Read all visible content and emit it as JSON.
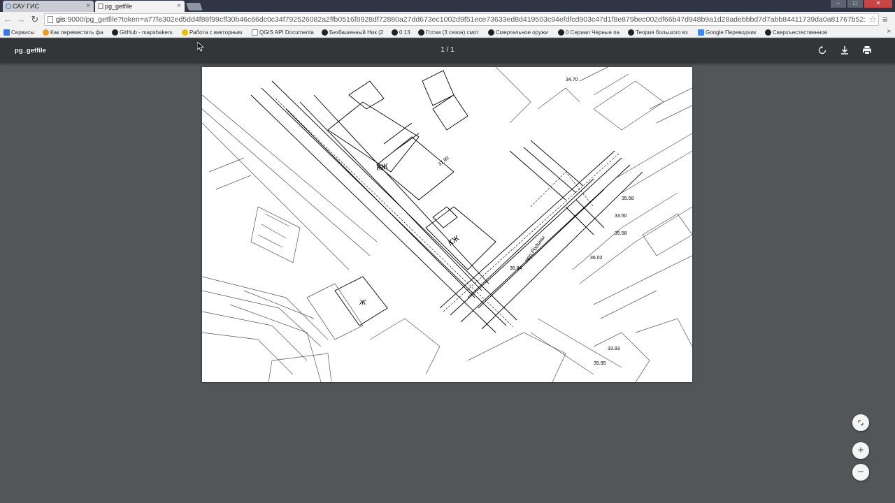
{
  "tabs": [
    {
      "title": "САУ ГИС",
      "active": false
    },
    {
      "title": "pg_getfile",
      "active": true
    }
  ],
  "window_controls": {
    "minimize": "–",
    "maximize": "□",
    "close": "✕"
  },
  "toolbar": {
    "back_icon": "arrow-left-icon",
    "forward_icon": "arrow-right-icon",
    "reload_icon": "reload-icon",
    "url_host": "gis",
    "url_rest": ":9000/pg_getfile?token=a77fe302ed5dd4f88f99cff30b46c66dc0c34f792526082a2ffb0516f8928df72880a27dd673ec1002d9f51ece73633ed8d419503c94efdfcd903c47d1f8e879bec002df66b47d948b9a1d28adebbbd7d7abb84411739da0a81767b52:"
  },
  "bookmarks": [
    {
      "label": "Сервисы",
      "color": "#3b78e7"
    },
    {
      "label": "Как переместить фа",
      "color": "#f09a1a"
    },
    {
      "label": "GitHub - mapshakers",
      "color": "#222222"
    },
    {
      "label": "Работа с векторным",
      "color": "#e8c100"
    },
    {
      "label": "QGIS API Documenta",
      "color": "#888888"
    },
    {
      "label": "Безбашенный Ник (2",
      "color": "#222222"
    },
    {
      "label": "0 13",
      "color": "#222222"
    },
    {
      "label": "Готэм (3 сезон) смот",
      "color": "#222222"
    },
    {
      "label": "Смертельное оружи",
      "color": "#222222"
    },
    {
      "label": "0 Сериал Черные па",
      "color": "#222222"
    },
    {
      "label": "Теория большого вз",
      "color": "#222222"
    },
    {
      "label": "Google Переводчик",
      "color": "#4285f4"
    },
    {
      "label": "Сверхъестественное",
      "color": "#222222"
    }
  ],
  "pdf_viewer": {
    "title": "pg_getfile",
    "current_page": "1",
    "separator": "/",
    "total_pages": "1",
    "tools": [
      "rotate-icon",
      "download-icon",
      "print-icon"
    ]
  },
  "zoom_controls": {
    "fit": "fit-page-icon",
    "zoom_in": "+",
    "zoom_out": "−"
  },
  "document": {
    "map_labels": [
      "КЖ",
      "КЖ",
      "Ж",
      "пер.Родины",
      "37.90",
      "35.58",
      "36.02",
      "33.50",
      "33.93",
      "35.95",
      "34.70",
      "35.58",
      "36.84"
    ]
  }
}
